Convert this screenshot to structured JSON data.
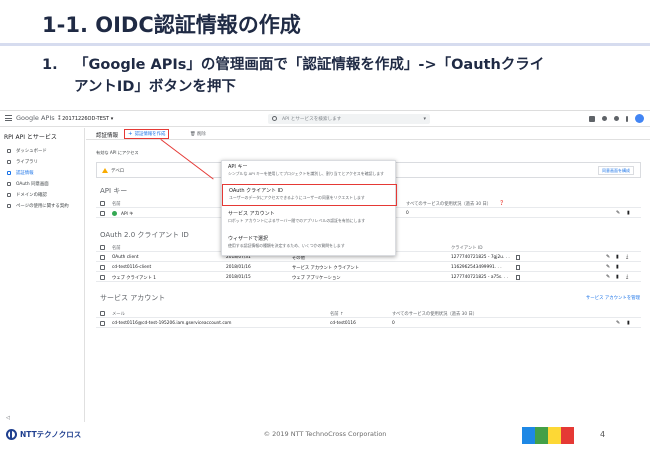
{
  "slide": {
    "title": "1-1. OIDC認証情報の作成",
    "step_num": "1.",
    "step_line1": "「Google APIs」の管理画面で「認証情報を作成」->「Oauthクライ",
    "step_line2": "アントID」ボタンを押下"
  },
  "console": {
    "brand": "Google APIs",
    "project": "20171226OD-TEST",
    "search_placeholder": "API とサービスを検索します",
    "sidebar": {
      "title": "API とサービス",
      "items": [
        {
          "label": "ダッシュボード"
        },
        {
          "label": "ライブラリ"
        },
        {
          "label": "認証情報"
        },
        {
          "label": "OAuth 同意画面"
        },
        {
          "label": "ドメインの確認"
        },
        {
          "label": "ページの使用に関する契約"
        }
      ]
    },
    "page_heading": "認証情報",
    "create_button": "認証情報を作成",
    "delete_button": "削除",
    "note": "有効な API にアクセス",
    "warning_start": "デベロ",
    "warning_end": "があります。",
    "warning_link": "詳細",
    "warning_button": "同意画面を構成",
    "dropdown": [
      {
        "title": "API キー",
        "desc": "シンプルな API キーを使用してプロジェクトを識別し、割り当てとアクセスを確認します"
      },
      {
        "title": "OAuth クライアント ID",
        "desc": "ユーザーのデータにアクセスできるようにユーザーの同意をリクエストします"
      },
      {
        "title": "サービス アカウント",
        "desc": "ロボット アカウントによるサーバー間でのアプリレベルの認証を有効にします"
      },
      {
        "title": "ウィザードで選択",
        "desc": "使用する認証情報の種類を決定するため、いくつかの質問をします"
      }
    ],
    "api_keys": {
      "heading": "API キー",
      "cols": [
        "名前",
        "すべてのサービスの使用状況（過去 30 日）"
      ],
      "rows": [
        {
          "name": "API キ",
          "key": "SyBjY7j... 2B8EYFqdsbs",
          "usage": "0"
        }
      ]
    },
    "oauth": {
      "heading": "OAuth 2.0 クライアント ID",
      "cols": [
        "名前",
        "作成日 ↓",
        "種類",
        "クライアント ID"
      ],
      "rows": [
        {
          "name": "OAuth client",
          "date": "2018/07/31",
          "type": "その他",
          "id": "1277740721825 - 7gj2u. . ."
        },
        {
          "name": "cd-test0116-client",
          "date": "2018/01/16",
          "type": "サービス アカウント クライアント",
          "id": "1162962543499991. . ."
        },
        {
          "name": "ウェブ クライアント 1",
          "date": "2018/01/15",
          "type": "ウェブ アプリケーション",
          "id": "1277740721825 - a75s. . ."
        }
      ]
    },
    "service_accounts": {
      "heading": "サービス アカウント",
      "manage_link": "サービス アカウントを管理",
      "cols": [
        "メール",
        "名前 ↑",
        "すべてのサービスの使用状況（過去 30 日）"
      ],
      "rows": [
        {
          "email": "cd-test0116@cd-test-195206.iam.gserviceaccount.com",
          "name": "cd-test0116",
          "usage": "0"
        }
      ]
    }
  },
  "footer": {
    "logo": "NTTテクノクロス",
    "copyright": "© 2019 NTT TechnoCross Corporation",
    "page": "4"
  },
  "colors": {
    "highlight": "#e53935",
    "link": "#1a73e8",
    "title": "#1f2a44",
    "brand_bar": [
      "#1e88e5",
      "#43a047",
      "#fdd835",
      "#e53935"
    ]
  }
}
